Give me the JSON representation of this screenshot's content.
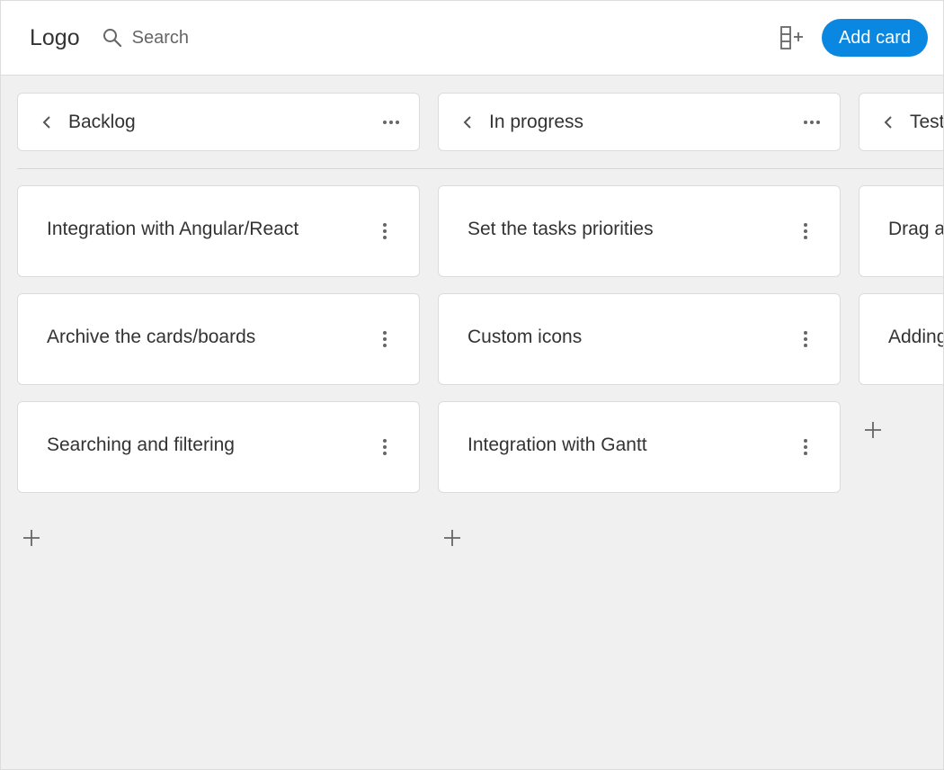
{
  "app": {
    "logo": "Logo"
  },
  "search": {
    "placeholder": "Search"
  },
  "toolbar": {
    "add_card_label": "Add card",
    "add_column_icon": "add-column-icon"
  },
  "columns": [
    {
      "title": "Backlog",
      "cards": [
        {
          "title": "Integration with Angular/React"
        },
        {
          "title": "Archive the cards/boards"
        },
        {
          "title": "Searching and filtering"
        }
      ]
    },
    {
      "title": "In progress",
      "cards": [
        {
          "title": "Set the tasks priorities"
        },
        {
          "title": "Custom icons"
        },
        {
          "title": "Integration with Gantt"
        }
      ]
    },
    {
      "title": "Testing",
      "cards": [
        {
          "title": "Drag and drop"
        },
        {
          "title": "Adding images"
        }
      ]
    }
  ],
  "colors": {
    "accent": "#0a87e0",
    "board_bg": "#f0f0f0",
    "border": "#dcdcdc",
    "text": "#333333",
    "muted": "#666666"
  }
}
